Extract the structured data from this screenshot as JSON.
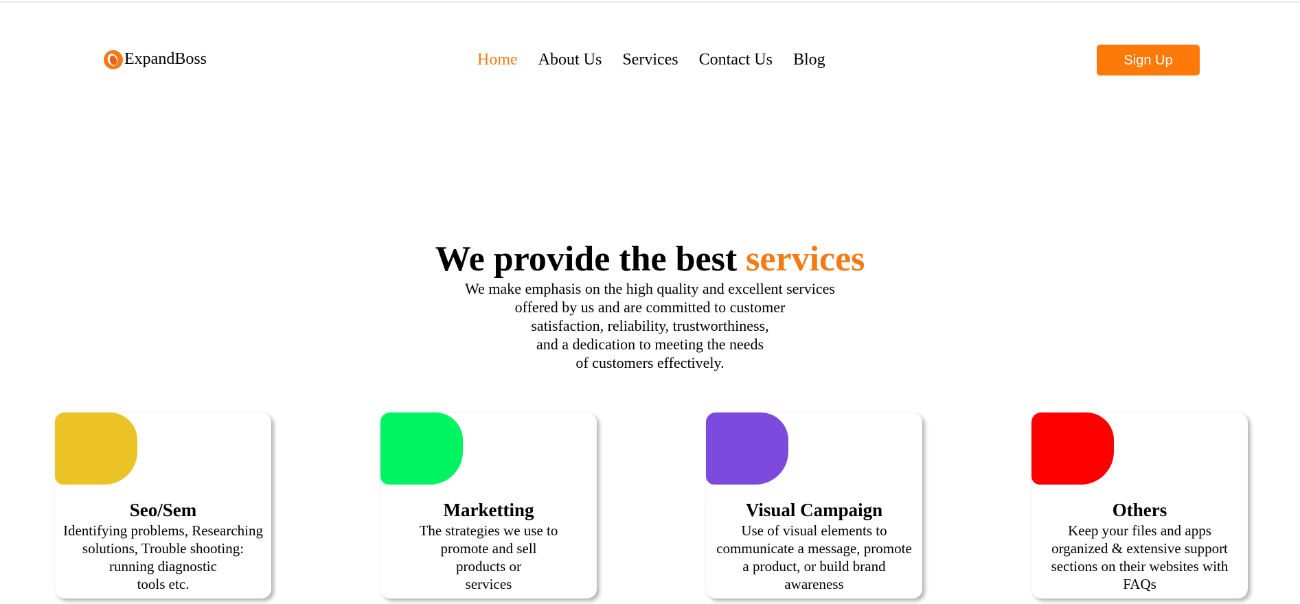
{
  "brand": {
    "name": "ExpandBoss",
    "accent_color": "#f57a16",
    "icon": "logo-ring-icon"
  },
  "nav": {
    "items": [
      {
        "label": "Home",
        "active": true
      },
      {
        "label": "About Us",
        "active": false
      },
      {
        "label": "Services",
        "active": false
      },
      {
        "label": "Contact Us",
        "active": false
      },
      {
        "label": "Blog",
        "active": false
      }
    ]
  },
  "header": {
    "signup_label": "Sign Up",
    "signup_color": "#fd7a0a"
  },
  "hero": {
    "title_prefix": "We provide the best ",
    "title_accent": "services",
    "subtitle_lines": [
      "We make emphasis on the high quality and excellent services",
      "offered by us and are committed to customer",
      "satisfaction, reliability, trustworthiness,",
      "and a dedication to meeting the needs",
      "of customers effectively."
    ]
  },
  "services": [
    {
      "title": "Seo/Sem",
      "color": "#ebc324",
      "desc_lines": [
        "Identifying problems, Researching",
        "solutions, Trouble shooting:",
        "running diagnostic",
        "tools etc."
      ]
    },
    {
      "title": "Marketting",
      "color": "#00f462",
      "desc_lines": [
        "The strategies we use to",
        "promote and sell",
        "products or",
        "services"
      ]
    },
    {
      "title": "Visual Campaign",
      "color": "#7c4bdd",
      "desc_lines": [
        "Use of visual elements to",
        "communicate a message, promote",
        "a product, or build brand",
        "awareness"
      ]
    },
    {
      "title": "Others",
      "color": "#ff0000",
      "desc_lines": [
        "Keep your files and apps",
        "organized & extensive support",
        "sections on their websites with",
        "FAQs"
      ]
    }
  ]
}
